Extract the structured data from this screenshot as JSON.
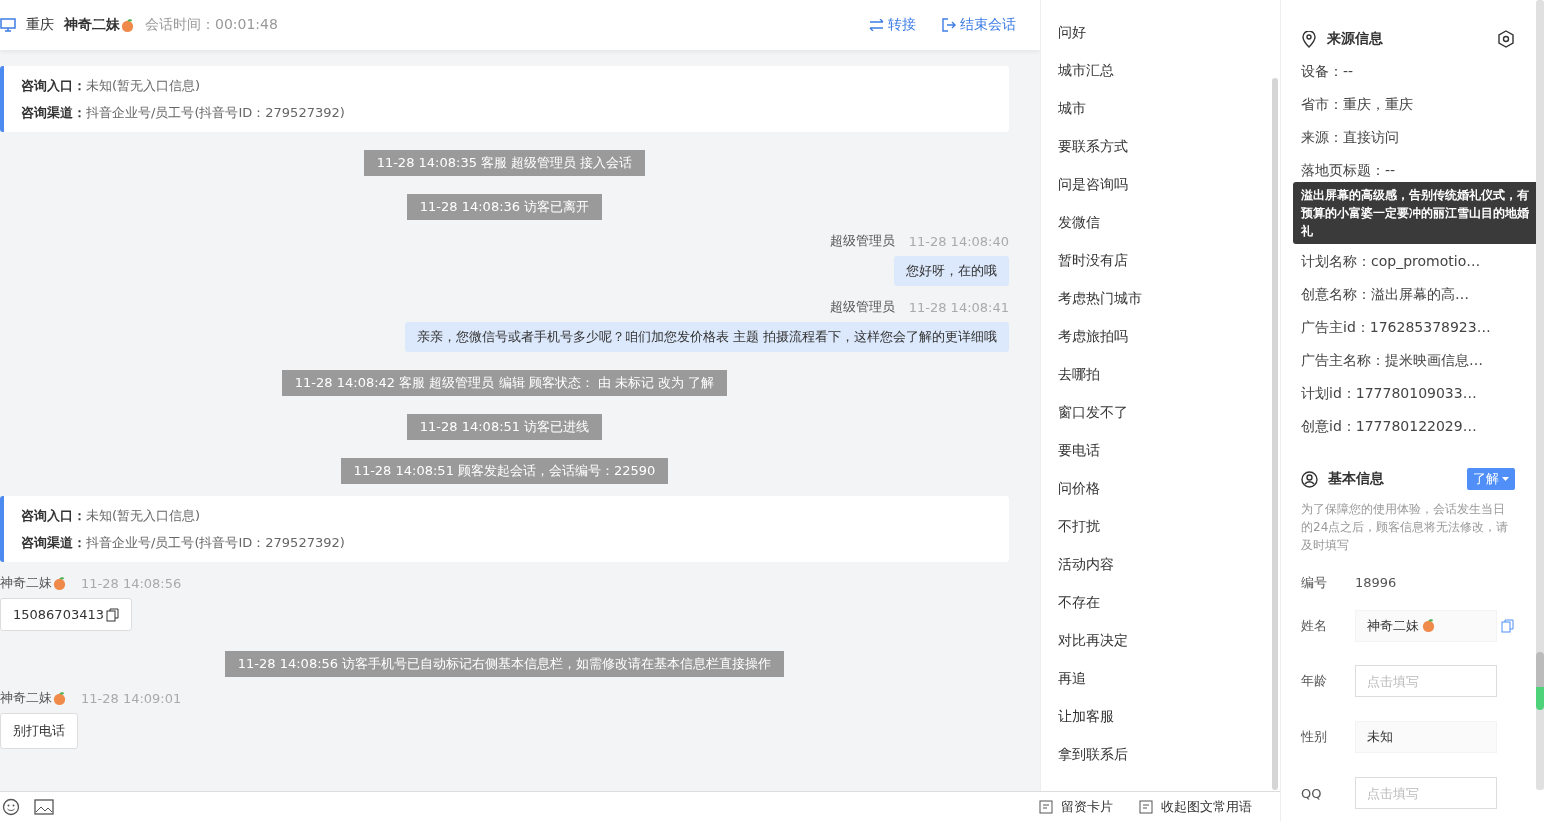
{
  "header": {
    "city": "重庆",
    "visitor_name": "神奇二妹",
    "session_time": "会话时间：00:01:48",
    "actions": [
      {
        "kind": "transfer",
        "label": "转接"
      },
      {
        "kind": "end",
        "label": "结束会话"
      }
    ]
  },
  "messages": [
    {
      "kind": "info",
      "rows": [
        {
          "label": "咨询入口：",
          "value": "未知(暂无入口信息)"
        },
        {
          "label": "咨询渠道：",
          "value": "抖音企业号/员工号(抖音号ID：279527392)"
        }
      ]
    },
    {
      "kind": "system",
      "text": "11-28 14:08:35 客服 超级管理员 接入会话"
    },
    {
      "kind": "system",
      "text": "11-28 14:08:36 访客已离开"
    },
    {
      "kind": "agent",
      "name": "超级管理员",
      "time": "11-28 14:08:40",
      "text": "您好呀，在的哦"
    },
    {
      "kind": "agent",
      "name": "超级管理员",
      "time": "11-28 14:08:41",
      "text": "亲亲，您微信号或者手机号多少呢？咱们加您发价格表 主题 拍摄流程看下，这样您会了解的更详细哦"
    },
    {
      "kind": "system",
      "text": "11-28 14:08:42 客服 超级管理员 编辑 顾客状态： 由 未标记 改为 了解"
    },
    {
      "kind": "system",
      "text": "11-28 14:08:51 访客已进线"
    },
    {
      "kind": "system",
      "text": "11-28 14:08:51 顾客发起会话，会话编号：22590"
    },
    {
      "kind": "info",
      "rows": [
        {
          "label": "咨询入口：",
          "value": "未知(暂无入口信息)"
        },
        {
          "label": "咨询渠道：",
          "value": "抖音企业号/员工号(抖音号ID：279527392)"
        }
      ]
    },
    {
      "kind": "visitor",
      "name": "神奇二妹",
      "time": "11-28 14:08:56",
      "text": "15086703413",
      "copyable": true
    },
    {
      "kind": "system",
      "text": "11-28 14:08:56 访客手机号已自动标记右侧基本信息栏，如需修改请在基本信息栏直接操作"
    },
    {
      "kind": "visitor",
      "name": "神奇二妹",
      "time": "11-28 14:09:01",
      "text": "别打电话",
      "copyable": false
    }
  ],
  "quick_replies": [
    "问好",
    "城市汇总",
    "城市",
    "要联系方式",
    "问是咨询吗",
    "发微信",
    "暂时没有店",
    "考虑热门城市",
    "考虑旅拍吗",
    "去哪拍",
    "窗口发不了",
    "要电话",
    "问价格",
    "不打扰",
    "活动内容",
    "不存在",
    "对比再决定",
    "再追",
    "让加客服",
    "拿到联系后"
  ],
  "bottom_bar": {
    "actions": [
      "留资卡片",
      "收起图文常用语"
    ]
  },
  "source_info": {
    "title": "来源信息",
    "rows_above_tooltip": [
      "设备：--",
      "省市：重庆，重庆",
      "来源：直接访问",
      "落地页标题：--"
    ],
    "rows": [
      "计划名称：cop_promotio…",
      "创意名称：溢出屏幕的高…",
      "广告主id：176285378923…",
      "广告主名称：提米映画信息…",
      "计划id：177780109033…",
      "创意id：177780122029…"
    ],
    "tooltip": "溢出屏幕的高级感，告别传统婚礼仪式，有预算的小富婆一定要冲的丽江雪山目的地婚礼"
  },
  "basic_info": {
    "title": "基本信息",
    "status": "了解",
    "note": "为了保障您的使用体验，会话发生当日的24点之后，顾客信息将无法修改，请及时填写",
    "fields": [
      {
        "kind": "text",
        "label": "编号",
        "value": "18996"
      },
      {
        "kind": "name",
        "label": "姓名",
        "value": "神奇二妹"
      },
      {
        "kind": "input",
        "label": "年龄",
        "placeholder": "点击填写"
      },
      {
        "kind": "select",
        "label": "性别",
        "value": "未知"
      },
      {
        "kind": "input",
        "label": "QQ",
        "placeholder": "点击填写"
      }
    ]
  }
}
